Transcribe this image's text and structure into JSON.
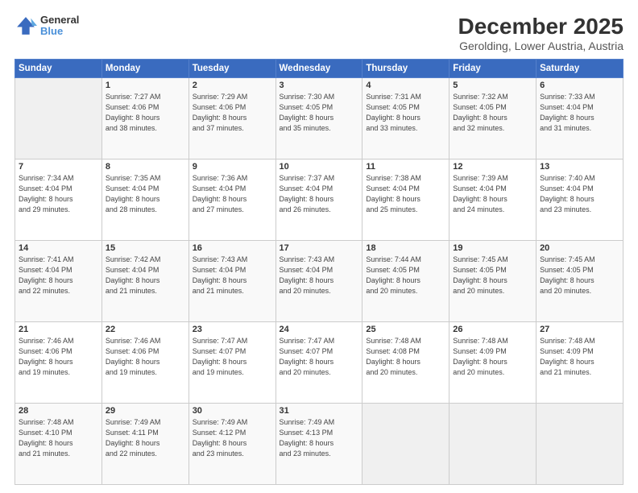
{
  "logo": {
    "line1": "General",
    "line2": "Blue"
  },
  "title": "December 2025",
  "subtitle": "Gerolding, Lower Austria, Austria",
  "header_days": [
    "Sunday",
    "Monday",
    "Tuesday",
    "Wednesday",
    "Thursday",
    "Friday",
    "Saturday"
  ],
  "weeks": [
    [
      {
        "day": "",
        "info": ""
      },
      {
        "day": "1",
        "info": "Sunrise: 7:27 AM\nSunset: 4:06 PM\nDaylight: 8 hours\nand 38 minutes."
      },
      {
        "day": "2",
        "info": "Sunrise: 7:29 AM\nSunset: 4:06 PM\nDaylight: 8 hours\nand 37 minutes."
      },
      {
        "day": "3",
        "info": "Sunrise: 7:30 AM\nSunset: 4:05 PM\nDaylight: 8 hours\nand 35 minutes."
      },
      {
        "day": "4",
        "info": "Sunrise: 7:31 AM\nSunset: 4:05 PM\nDaylight: 8 hours\nand 33 minutes."
      },
      {
        "day": "5",
        "info": "Sunrise: 7:32 AM\nSunset: 4:05 PM\nDaylight: 8 hours\nand 32 minutes."
      },
      {
        "day": "6",
        "info": "Sunrise: 7:33 AM\nSunset: 4:04 PM\nDaylight: 8 hours\nand 31 minutes."
      }
    ],
    [
      {
        "day": "7",
        "info": "Sunrise: 7:34 AM\nSunset: 4:04 PM\nDaylight: 8 hours\nand 29 minutes."
      },
      {
        "day": "8",
        "info": "Sunrise: 7:35 AM\nSunset: 4:04 PM\nDaylight: 8 hours\nand 28 minutes."
      },
      {
        "day": "9",
        "info": "Sunrise: 7:36 AM\nSunset: 4:04 PM\nDaylight: 8 hours\nand 27 minutes."
      },
      {
        "day": "10",
        "info": "Sunrise: 7:37 AM\nSunset: 4:04 PM\nDaylight: 8 hours\nand 26 minutes."
      },
      {
        "day": "11",
        "info": "Sunrise: 7:38 AM\nSunset: 4:04 PM\nDaylight: 8 hours\nand 25 minutes."
      },
      {
        "day": "12",
        "info": "Sunrise: 7:39 AM\nSunset: 4:04 PM\nDaylight: 8 hours\nand 24 minutes."
      },
      {
        "day": "13",
        "info": "Sunrise: 7:40 AM\nSunset: 4:04 PM\nDaylight: 8 hours\nand 23 minutes."
      }
    ],
    [
      {
        "day": "14",
        "info": "Sunrise: 7:41 AM\nSunset: 4:04 PM\nDaylight: 8 hours\nand 22 minutes."
      },
      {
        "day": "15",
        "info": "Sunrise: 7:42 AM\nSunset: 4:04 PM\nDaylight: 8 hours\nand 21 minutes."
      },
      {
        "day": "16",
        "info": "Sunrise: 7:43 AM\nSunset: 4:04 PM\nDaylight: 8 hours\nand 21 minutes."
      },
      {
        "day": "17",
        "info": "Sunrise: 7:43 AM\nSunset: 4:04 PM\nDaylight: 8 hours\nand 20 minutes."
      },
      {
        "day": "18",
        "info": "Sunrise: 7:44 AM\nSunset: 4:05 PM\nDaylight: 8 hours\nand 20 minutes."
      },
      {
        "day": "19",
        "info": "Sunrise: 7:45 AM\nSunset: 4:05 PM\nDaylight: 8 hours\nand 20 minutes."
      },
      {
        "day": "20",
        "info": "Sunrise: 7:45 AM\nSunset: 4:05 PM\nDaylight: 8 hours\nand 20 minutes."
      }
    ],
    [
      {
        "day": "21",
        "info": "Sunrise: 7:46 AM\nSunset: 4:06 PM\nDaylight: 8 hours\nand 19 minutes."
      },
      {
        "day": "22",
        "info": "Sunrise: 7:46 AM\nSunset: 4:06 PM\nDaylight: 8 hours\nand 19 minutes."
      },
      {
        "day": "23",
        "info": "Sunrise: 7:47 AM\nSunset: 4:07 PM\nDaylight: 8 hours\nand 19 minutes."
      },
      {
        "day": "24",
        "info": "Sunrise: 7:47 AM\nSunset: 4:07 PM\nDaylight: 8 hours\nand 20 minutes."
      },
      {
        "day": "25",
        "info": "Sunrise: 7:48 AM\nSunset: 4:08 PM\nDaylight: 8 hours\nand 20 minutes."
      },
      {
        "day": "26",
        "info": "Sunrise: 7:48 AM\nSunset: 4:09 PM\nDaylight: 8 hours\nand 20 minutes."
      },
      {
        "day": "27",
        "info": "Sunrise: 7:48 AM\nSunset: 4:09 PM\nDaylight: 8 hours\nand 21 minutes."
      }
    ],
    [
      {
        "day": "28",
        "info": "Sunrise: 7:48 AM\nSunset: 4:10 PM\nDaylight: 8 hours\nand 21 minutes."
      },
      {
        "day": "29",
        "info": "Sunrise: 7:49 AM\nSunset: 4:11 PM\nDaylight: 8 hours\nand 22 minutes."
      },
      {
        "day": "30",
        "info": "Sunrise: 7:49 AM\nSunset: 4:12 PM\nDaylight: 8 hours\nand 23 minutes."
      },
      {
        "day": "31",
        "info": "Sunrise: 7:49 AM\nSunset: 4:13 PM\nDaylight: 8 hours\nand 23 minutes."
      },
      {
        "day": "",
        "info": ""
      },
      {
        "day": "",
        "info": ""
      },
      {
        "day": "",
        "info": ""
      }
    ]
  ]
}
